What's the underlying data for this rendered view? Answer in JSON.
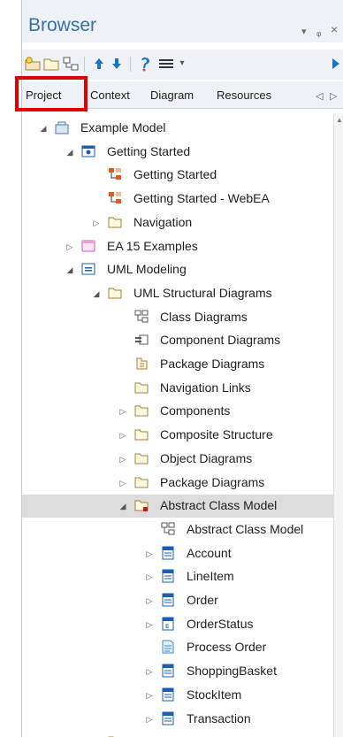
{
  "window": {
    "title": "Browser",
    "pin_glyph": "▾",
    "autohide_glyph": "ᵩ",
    "close_glyph": "×"
  },
  "toolbar": {
    "icons": [
      "new-package-icon",
      "new-folder-icon",
      "new-diagram-icon",
      "move-up-icon",
      "move-down-icon",
      "element-properties-icon",
      "menu-icon",
      "menu-dropdown-icon",
      "run-arrow-icon"
    ],
    "menu_dropdown_glyph": "▾"
  },
  "tabs": [
    {
      "label": "Project",
      "active": true
    },
    {
      "label": "Context"
    },
    {
      "label": "Diagram"
    },
    {
      "label": "Resources"
    }
  ],
  "tab_nav": {
    "left_glyph": "◁",
    "right_glyph": "▷"
  },
  "tree": [
    {
      "label": "Example Model",
      "level": 0,
      "expander": "expanded",
      "icon": "model-icon"
    },
    {
      "label": "Getting Started",
      "level": 1,
      "expander": "expanded",
      "icon": "view-icon"
    },
    {
      "label": "Getting Started",
      "level": 2,
      "expander": "none",
      "icon": "diagram-icon"
    },
    {
      "label": "Getting Started - WebEA",
      "level": 2,
      "expander": "none",
      "icon": "diagram-icon"
    },
    {
      "label": "Navigation",
      "level": 2,
      "expander": "collapsed",
      "icon": "package-icon"
    },
    {
      "label": "EA 15 Examples",
      "level": 1,
      "expander": "collapsed",
      "icon": "view-pink-icon"
    },
    {
      "label": "UML Modeling",
      "level": 1,
      "expander": "expanded",
      "icon": "view-list-icon"
    },
    {
      "label": "UML Structural Diagrams",
      "level": 2,
      "expander": "expanded",
      "icon": "package-icon"
    },
    {
      "label": "Class Diagrams",
      "level": 3,
      "expander": "none",
      "icon": "class-diagram-icon"
    },
    {
      "label": "Component Diagrams",
      "level": 3,
      "expander": "none",
      "icon": "component-diagram-icon"
    },
    {
      "label": "Package Diagrams",
      "level": 3,
      "expander": "none",
      "icon": "package-diagram-icon"
    },
    {
      "label": "Navigation Links",
      "level": 3,
      "expander": "none",
      "icon": "package-icon"
    },
    {
      "label": "Components",
      "level": 3,
      "expander": "collapsed",
      "icon": "package-icon"
    },
    {
      "label": "Composite Structure",
      "level": 3,
      "expander": "collapsed",
      "icon": "package-icon"
    },
    {
      "label": "Object Diagrams",
      "level": 3,
      "expander": "collapsed",
      "icon": "package-icon"
    },
    {
      "label": "Package Diagrams",
      "level": 3,
      "expander": "collapsed",
      "icon": "package-icon"
    },
    {
      "label": "Abstract Class Model",
      "level": 3,
      "expander": "expanded",
      "icon": "package-locked-icon",
      "selected": true
    },
    {
      "label": "Abstract Class Model",
      "level": 4,
      "expander": "none",
      "icon": "class-diagram-icon"
    },
    {
      "label": "Account",
      "level": 4,
      "expander": "collapsed",
      "icon": "class-icon"
    },
    {
      "label": "LineItem",
      "level": 4,
      "expander": "collapsed",
      "icon": "class-icon"
    },
    {
      "label": "Order",
      "level": 4,
      "expander": "collapsed",
      "icon": "class-icon"
    },
    {
      "label": "OrderStatus",
      "level": 4,
      "expander": "collapsed",
      "icon": "enumeration-icon"
    },
    {
      "label": "Process Order",
      "level": 4,
      "expander": "none",
      "icon": "note-icon"
    },
    {
      "label": "ShoppingBasket",
      "level": 4,
      "expander": "collapsed",
      "icon": "class-icon"
    },
    {
      "label": "StockItem",
      "level": 4,
      "expander": "collapsed",
      "icon": "class-icon"
    },
    {
      "label": "Transaction",
      "level": 4,
      "expander": "collapsed",
      "icon": "class-icon"
    },
    {
      "label": "",
      "level": 2,
      "expander": "none",
      "icon": "package-icon"
    }
  ],
  "colors": {
    "title": "#3a6ea5",
    "header_bg": "#eef2f6",
    "highlight_box": "#e10000",
    "selected_row": "#dcdcdc",
    "toolbar_blue": "#1a73c8",
    "folder": "#a08040"
  }
}
